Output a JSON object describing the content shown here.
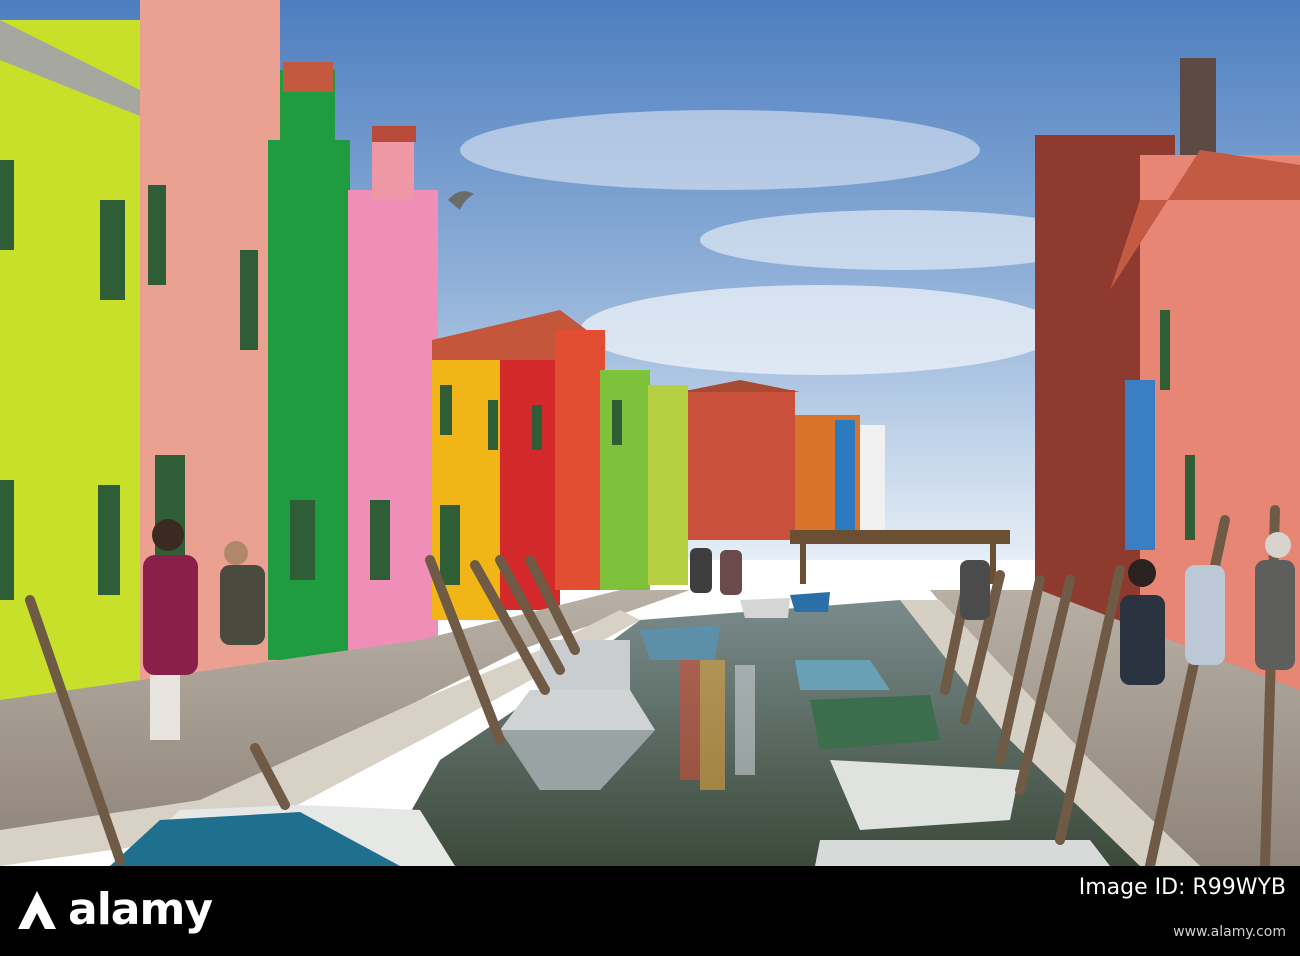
{
  "footer": {
    "brand": "alamy",
    "image_id_label": "Image ID: R99WYB",
    "website": "www.alamy.com"
  },
  "colors": {
    "sky_top": "#4f7fc0",
    "sky_bottom": "#dfe9f3",
    "canal_water": "#5a6a55",
    "pavement": "#a99f93"
  }
}
